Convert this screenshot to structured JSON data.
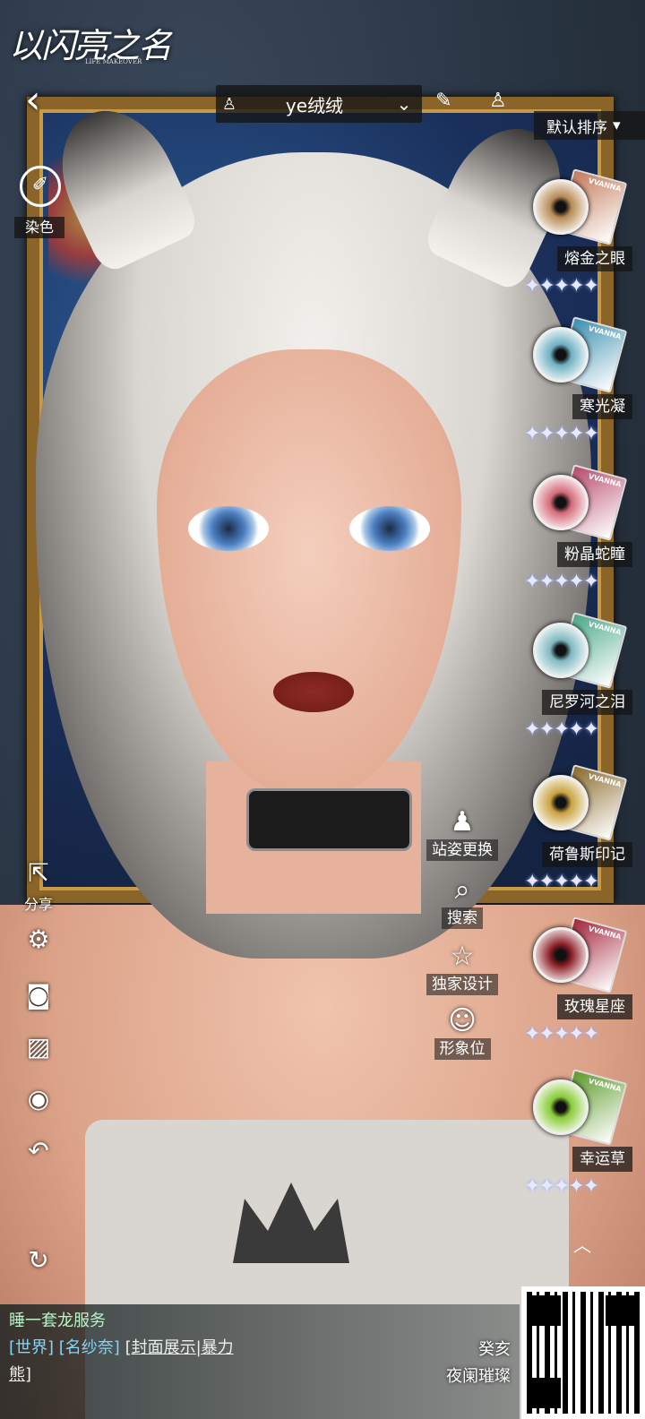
{
  "app": {
    "logo_text": "以闪亮之名",
    "logo_subtitle": "LIFE MAKEOVER"
  },
  "topbar": {
    "profile_name": "ye绒绒",
    "dress_icon": "dress-icon",
    "chevron_icon": "double-chevron-down-icon",
    "pen_icon": "pen-icon"
  },
  "sort": {
    "label": "默认排序",
    "arrow": "▾"
  },
  "left_toolbar": {
    "dye_label": "染色",
    "share_label": "分享"
  },
  "actions": {
    "pose_label": "站姿更换",
    "search_label": "搜索",
    "exclusive_label": "独家设计",
    "image_slot_label": "形象位"
  },
  "eyes": [
    {
      "name": "熔金之眼",
      "brand": "VVANNA",
      "color": "#b78a55",
      "card": "#c47a5a",
      "stars": "✦✦✦✦✦"
    },
    {
      "name": "寒光凝",
      "brand": "VVANNA",
      "color": "#6fb0c2",
      "card": "#3c8fb0",
      "stars": "✦✦✦✦✦"
    },
    {
      "name": "粉晶蛇瞳",
      "brand": "VVANNA",
      "color": "#d46a7a",
      "card": "#b84a6c",
      "stars": "✦✦✦✦✦"
    },
    {
      "name": "尼罗河之泪",
      "brand": "VVANNA",
      "color": "#7fb8c0",
      "card": "#4aa88a",
      "stars": "✦✦✦✦✦"
    },
    {
      "name": "荷鲁斯印记",
      "brand": "VVANNA",
      "color": "#c9a240",
      "card": "#8a6a2c",
      "stars": "✦✦✦✦✦"
    },
    {
      "name": "玫瑰星座",
      "brand": "VVANNA",
      "color": "#8a1c24",
      "card": "#a3243a",
      "stars": "✦✦✦✦✦"
    },
    {
      "name": "幸运草",
      "brand": "VVANNA",
      "color": "#8acb3a",
      "card": "#5c9a2a",
      "stars": "✦✦✦✦✦"
    }
  ],
  "chat": {
    "line1": "睡一套龙服务",
    "channel": "[世界]",
    "user": "[名纱奈]",
    "link": "[封面展示|暴力",
    "link_cont": "熊]",
    "right_name1": "癸亥",
    "right_name2": "夜阑璀璨"
  },
  "colors": {
    "accent_chat": "#b8f5c8",
    "channel": "#7fd6ff",
    "frame_gold": "#8a6428"
  }
}
